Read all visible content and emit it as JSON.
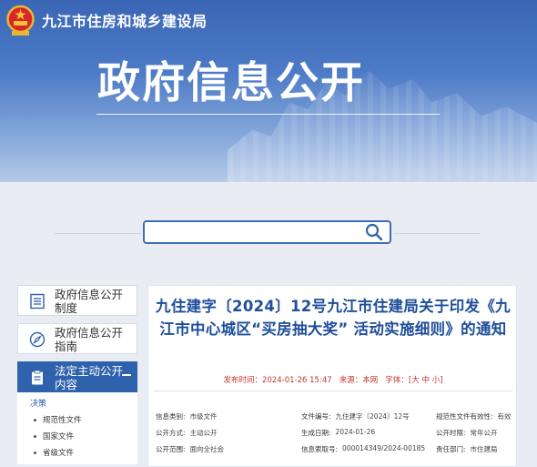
{
  "header": {
    "site_title": "九江市住房和城乡建设局",
    "hero_title": "政府信息公开"
  },
  "search": {
    "placeholder": "",
    "icon": "search-icon"
  },
  "sidebar": {
    "items": [
      {
        "label": "政府信息公开制度",
        "icon": "document-list-icon"
      },
      {
        "label": "政府信息公开指南",
        "icon": "compass-icon"
      },
      {
        "label": "法定主动公开内容",
        "icon": "clipboard-icon"
      }
    ],
    "submenu": {
      "heading": "决策",
      "items": [
        "规范性文件",
        "国家文件",
        "省级文件"
      ]
    }
  },
  "article": {
    "title": "九住建字〔2024〕12号九江市住建局关于印发《九江市中心城区“买房抽大奖” 活动实施细则》的通知",
    "publish_label": "发布时间：",
    "publish_time": "2024-01-26 15:47",
    "source_label": "来源：",
    "source": "本网",
    "font_label": "字体：",
    "font_sizes": "[大 中 小]",
    "info": [
      [
        {
          "k": "信息类别:",
          "v": "市级文件"
        },
        {
          "k": "文件编号:",
          "v": "九住建字〔2024〕12号"
        },
        {
          "k": "规范性文件有效性:",
          "v": "有效"
        }
      ],
      [
        {
          "k": "公开方式:",
          "v": "主动公开"
        },
        {
          "k": "生成日期:",
          "v": "2024-01-26"
        },
        {
          "k": "公开时限:",
          "v": "常年公开"
        }
      ],
      [
        {
          "k": "公开范围:",
          "v": "面向全社会"
        },
        {
          "k": "信息索取号:",
          "v": "000014349/2024-00185"
        },
        {
          "k": "责任部门:",
          "v": "市住建局"
        }
      ]
    ]
  },
  "colors": {
    "primary": "#2f62ad",
    "title_blue": "#1f4e9a",
    "banner_top": "#3a66b5"
  }
}
